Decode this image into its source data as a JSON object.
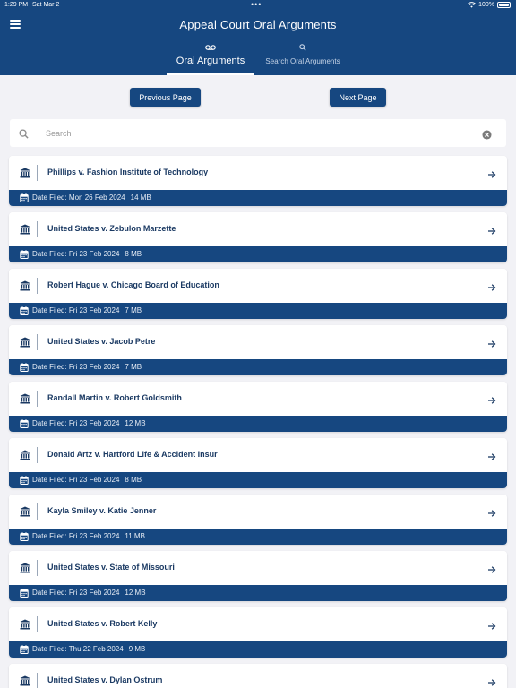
{
  "status_bar": {
    "time": "1:29 PM",
    "date": "Sat Mar 2",
    "battery": "100%"
  },
  "app": {
    "title": "Appeal Court Oral Arguments"
  },
  "tabs": [
    {
      "label": "Oral Arguments",
      "icon": "voicemail-icon",
      "selected": true
    },
    {
      "label": "Search Oral Arguments",
      "icon": "search-icon",
      "selected": false
    }
  ],
  "pager": {
    "previous_label": "Previous Page",
    "next_label": "Next Page"
  },
  "search": {
    "placeholder": "Search",
    "value": ""
  },
  "date_prefix": "Date Filed:",
  "cases": [
    {
      "title": "Phillips v. Fashion Institute of Technology",
      "date": "Mon 26 Feb 2024",
      "size": "14 MB"
    },
    {
      "title": "United States v. Zebulon Marzette",
      "date": "Fri 23 Feb 2024",
      "size": "8 MB"
    },
    {
      "title": "Robert Hague v. Chicago Board of Education",
      "date": "Fri 23 Feb 2024",
      "size": "7 MB"
    },
    {
      "title": "United States v. Jacob Petre",
      "date": "Fri 23 Feb 2024",
      "size": "7 MB"
    },
    {
      "title": "Randall Martin v. Robert Goldsmith",
      "date": "Fri 23 Feb 2024",
      "size": "12 MB"
    },
    {
      "title": "Donald Artz v. Hartford Life & Accident Insur",
      "date": "Fri 23 Feb 2024",
      "size": "8 MB"
    },
    {
      "title": "Kayla Smiley v. Katie Jenner",
      "date": "Fri 23 Feb 2024",
      "size": "11 MB"
    },
    {
      "title": "United States v. State of Missouri",
      "date": "Fri 23 Feb 2024",
      "size": "12 MB"
    },
    {
      "title": "United States v. Robert Kelly",
      "date": "Thu 22 Feb 2024",
      "size": "9 MB"
    },
    {
      "title": "United States v. Dylan Ostrum",
      "date": "",
      "size": ""
    }
  ],
  "colors": {
    "primary": "#164780",
    "background": "#f2f2f6",
    "card_title": "#1b3a63"
  }
}
